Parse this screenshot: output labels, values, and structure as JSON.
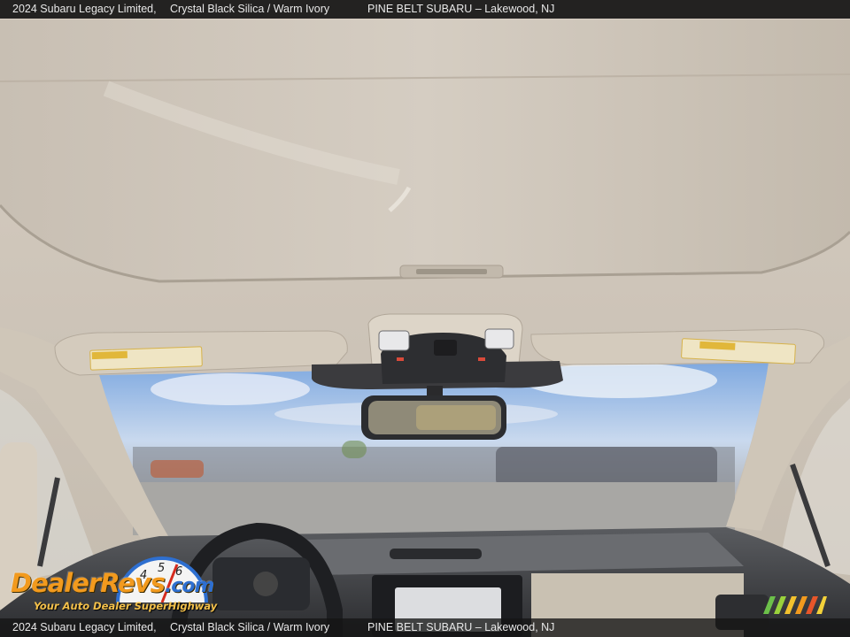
{
  "caption": {
    "model": "2024 Subaru Legacy Limited,",
    "colors": "Crystal Black Silica / Warm Ivory",
    "dealer": "PINE BELT SUBARU – Lakewood, NJ"
  },
  "watermark": {
    "brand": "DealerRevs",
    "domain": ".com",
    "tagline": "Your Auto Dealer SuperHighway",
    "gauge_numbers": [
      "4",
      "5",
      "6"
    ]
  },
  "colors": {
    "headliner": "#cfc6ba",
    "sky": "#8fb6e6",
    "caption_bg": "#141414",
    "brand_orange": "#f29a1e",
    "brand_blue": "#2e6fd0"
  },
  "icons": [
    "rearview-mirror-icon",
    "overhead-console-icon",
    "sun-visor-icon",
    "steering-wheel-icon",
    "sunroof-icon"
  ]
}
